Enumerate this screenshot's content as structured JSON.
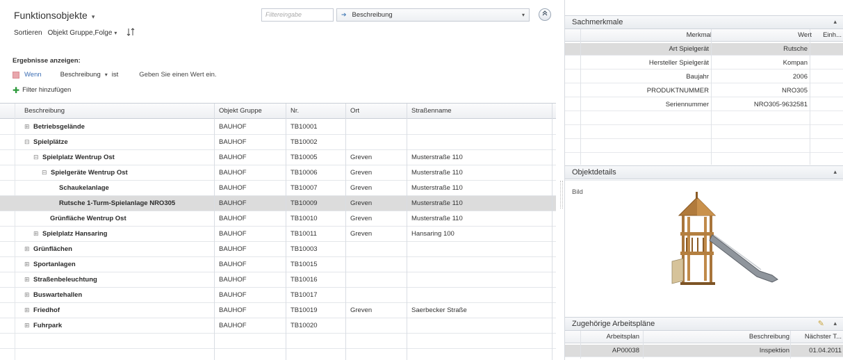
{
  "left": {
    "title": "Funktionsobjekte",
    "title_caret": "▾",
    "sort_label": "Sortieren",
    "sort_value": "Objekt Gruppe,Folge",
    "sort_caret": "▾",
    "sort_dir_icon": "sort-direction-icon",
    "filter_placeholder": "Filtereingabe",
    "field_select_value": "Beschreibung",
    "field_select_caret": "▾",
    "collapse_icon": "collapse-up-icon",
    "results_heading": "Ergebnisse anzeigen:",
    "condition": {
      "wenn": "Wenn",
      "field": "Beschreibung",
      "field_caret": "▾",
      "op": "ist",
      "hint": "Geben Sie einen Wert ein."
    },
    "add_filter": "Filter hinzufügen"
  },
  "grid": {
    "headers": [
      "Beschreibung",
      "Objekt Gruppe",
      "Nr.",
      "Ort",
      "Straßenname"
    ],
    "rows": [
      {
        "exp": "⊞",
        "desc": "Betriebsgelände",
        "group": "BAUHOF",
        "nr": "TB10001",
        "ort": "",
        "strasse": ""
      },
      {
        "exp": "⊟",
        "desc": "Spielplätze",
        "group": "BAUHOF",
        "nr": "TB10002",
        "ort": "",
        "strasse": ""
      },
      {
        "exp": "⊟",
        "desc": "Spielplatz Wentrup Ost",
        "group": "BAUHOF",
        "nr": "TB10005",
        "ort": "Greven",
        "strasse": "Musterstraße 110"
      },
      {
        "exp": "⊟",
        "desc": "Spielgeräte Wentrup Ost",
        "group": "BAUHOF",
        "nr": "TB10006",
        "ort": "Greven",
        "strasse": "Musterstraße 110"
      },
      {
        "exp": "",
        "desc": "Schaukelanlage",
        "group": "BAUHOF",
        "nr": "TB10007",
        "ort": "Greven",
        "strasse": "Musterstraße 110"
      },
      {
        "exp": "",
        "desc": "Rutsche 1-Turm-Spielanlage NRO305",
        "group": "BAUHOF",
        "nr": "TB10009",
        "ort": "Greven",
        "strasse": "Musterstraße 110"
      },
      {
        "exp": "",
        "desc": "Grünfläche Wentrup Ost",
        "group": "BAUHOF",
        "nr": "TB10010",
        "ort": "Greven",
        "strasse": "Musterstraße 110"
      },
      {
        "exp": "⊞",
        "desc": "Spielplatz Hansaring",
        "group": "BAUHOF",
        "nr": "TB10011",
        "ort": "Greven",
        "strasse": "Hansaring 100"
      },
      {
        "exp": "⊞",
        "desc": "Grünflächen",
        "group": "BAUHOF",
        "nr": "TB10003",
        "ort": "",
        "strasse": ""
      },
      {
        "exp": "⊞",
        "desc": "Sportanlagen",
        "group": "BAUHOF",
        "nr": "TB10015",
        "ort": "",
        "strasse": ""
      },
      {
        "exp": "⊞",
        "desc": "Straßenbeleuchtung",
        "group": "BAUHOF",
        "nr": "TB10016",
        "ort": "",
        "strasse": ""
      },
      {
        "exp": "⊞",
        "desc": "Buswartehallen",
        "group": "BAUHOF",
        "nr": "TB10017",
        "ort": "",
        "strasse": ""
      },
      {
        "exp": "⊞",
        "desc": "Friedhof",
        "group": "BAUHOF",
        "nr": "TB10019",
        "ort": "Greven",
        "strasse": "Saerbecker Straße"
      },
      {
        "exp": "⊞",
        "desc": "Fuhrpark",
        "group": "BAUHOF",
        "nr": "TB10020",
        "ort": "",
        "strasse": ""
      }
    ]
  },
  "right": {
    "sachmerkmale": {
      "title": "Sachmerkmale",
      "chevron": "▴",
      "headers": [
        "Merkmal",
        "Wert",
        "Einh..."
      ],
      "rows": [
        {
          "merkmal": "Art Spielgerät",
          "wert": "Rutsche"
        },
        {
          "merkmal": "Hersteller Spielgerät",
          "wert": "Kompan"
        },
        {
          "merkmal": "Baujahr",
          "wert": "2006"
        },
        {
          "merkmal": "PRODUKTNUMMER",
          "wert": "NRO305"
        },
        {
          "merkmal": "Seriennummer",
          "wert": "NRO305-9632581"
        }
      ]
    },
    "objektdetails": {
      "title": "Objektdetails",
      "chevron": "▴",
      "bild_label": "Bild"
    },
    "arbeitsplaene": {
      "title": "Zugehörige Arbeitspläne",
      "chevron": "▴",
      "edit_icon": "pencil-icon",
      "headers": [
        "Arbeitsplan",
        "Beschreibung",
        "Nächster T..."
      ],
      "rows": [
        {
          "plan": "AP00038",
          "beschreibung": "Inspektion",
          "naechster": "01.04.2011"
        }
      ]
    }
  },
  "colors": {
    "selected_row": "#dcdcdc",
    "link_blue": "#3b6db3",
    "add_green": "#2e9a3c"
  }
}
